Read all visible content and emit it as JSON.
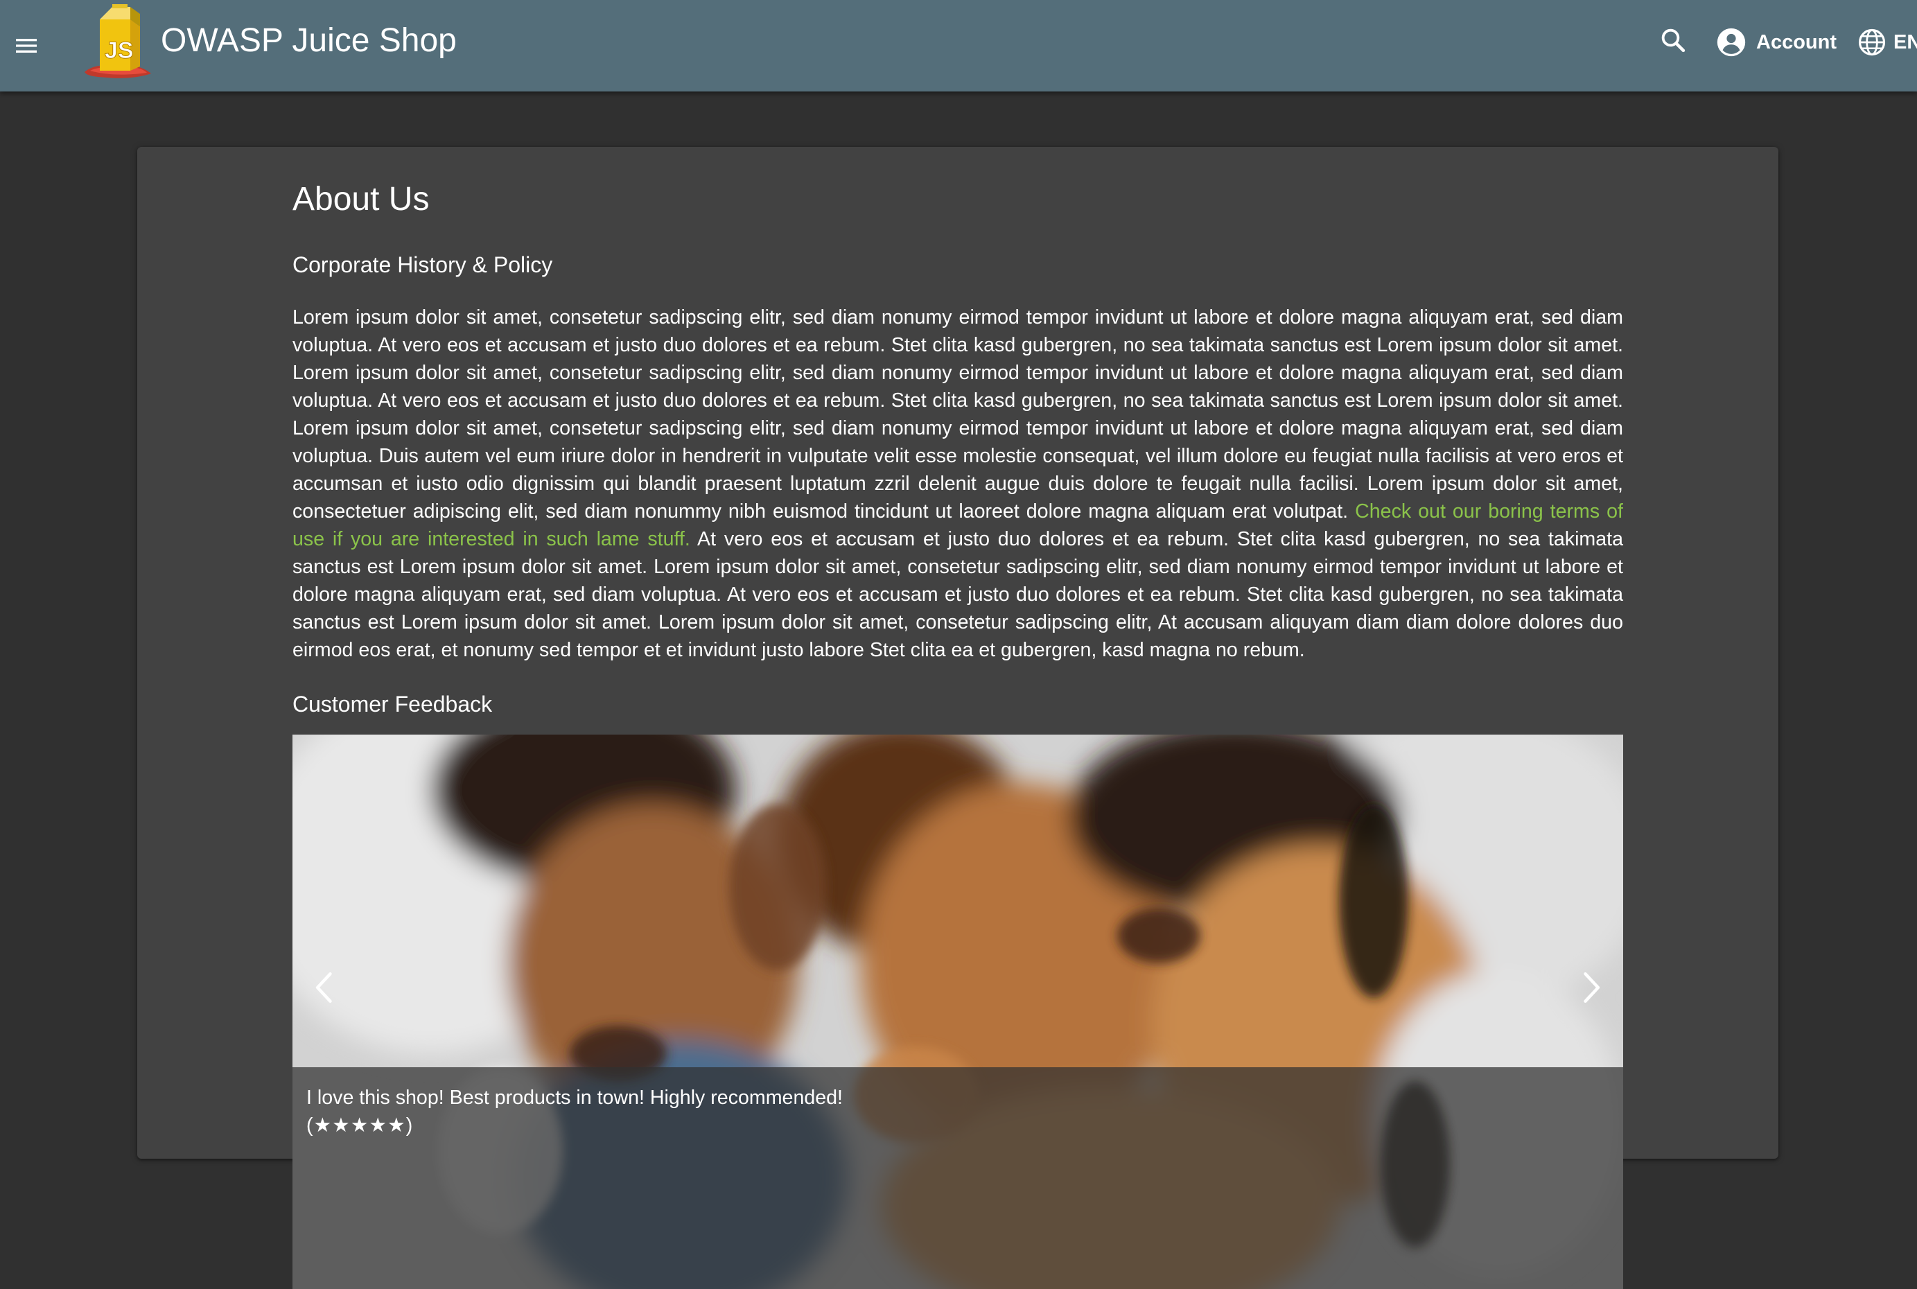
{
  "app": {
    "title": "OWASP Juice Shop",
    "logo_icon": "juice-shop-logo",
    "menu_icon": "hamburger-menu-icon"
  },
  "toolbar": {
    "search_icon": "search-icon",
    "account_label": "Account",
    "account_icon": "account-circle-icon",
    "language_label": "EN",
    "language_icon": "globe-icon"
  },
  "page": {
    "title": "About Us",
    "history_title": "Corporate History & Policy",
    "history_text_before_link": "Lorem ipsum dolor sit amet, consetetur sadipscing elitr, sed diam nonumy eirmod tempor invidunt ut labore et dolore magna aliquyam erat, sed diam voluptua. At vero eos et accusam et justo duo dolores et ea rebum. Stet clita kasd gubergren, no sea takimata sanctus est Lorem ipsum dolor sit amet. Lorem ipsum dolor sit amet, consetetur sadipscing elitr, sed diam nonumy eirmod tempor invidunt ut labore et dolore magna aliquyam erat, sed diam voluptua. At vero eos et accusam et justo duo dolores et ea rebum. Stet clita kasd gubergren, no sea takimata sanctus est Lorem ipsum dolor sit amet. Lorem ipsum dolor sit amet, consetetur sadipscing elitr, sed diam nonumy eirmod tempor invidunt ut labore et dolore magna aliquyam erat, sed diam voluptua. Duis autem vel eum iriure dolor in hendrerit in vulputate velit esse molestie consequat, vel illum dolore eu feugiat nulla facilisis at vero eros et accumsan et iusto odio dignissim qui blandit praesent luptatum zzril delenit augue duis dolore te feugait nulla facilisi. Lorem ipsum dolor sit amet, consectetuer adipiscing elit, sed diam nonummy nibh euismod tincidunt ut laoreet dolore magna aliquam erat volutpat.",
    "history_link_text": "Check out our boring terms of use if you are interested in such lame stuff.",
    "history_text_after_link": "At vero eos et accusam et justo duo dolores et ea rebum. Stet clita kasd gubergren, no sea takimata sanctus est Lorem ipsum dolor sit amet. Lorem ipsum dolor sit amet, consetetur sadipscing elitr, sed diam nonumy eirmod tempor invidunt ut labore et dolore magna aliquyam erat, sed diam voluptua. At vero eos et accusam et justo duo dolores et ea rebum. Stet clita kasd gubergren, no sea takimata sanctus est Lorem ipsum dolor sit amet. Lorem ipsum dolor sit amet, consetetur sadipscing elitr, At accusam aliquyam diam diam dolore dolores duo eirmod eos erat, et nonumy sed tempor et et invidunt justo labore Stet clita ea et gubergren, kasd magna no rebum.",
    "feedback_title": "Customer Feedback"
  },
  "carousel": {
    "prev_icon": "chevron-left-icon",
    "next_icon": "chevron-right-icon",
    "slide": {
      "comment": "I love this shop! Best products in town! Highly recommended!",
      "rating_text": "(★★★★★)",
      "rating": 5
    }
  },
  "colors": {
    "toolbar": "#546e7a",
    "background": "#303030",
    "card": "#424242",
    "link": "#8bc34a"
  }
}
